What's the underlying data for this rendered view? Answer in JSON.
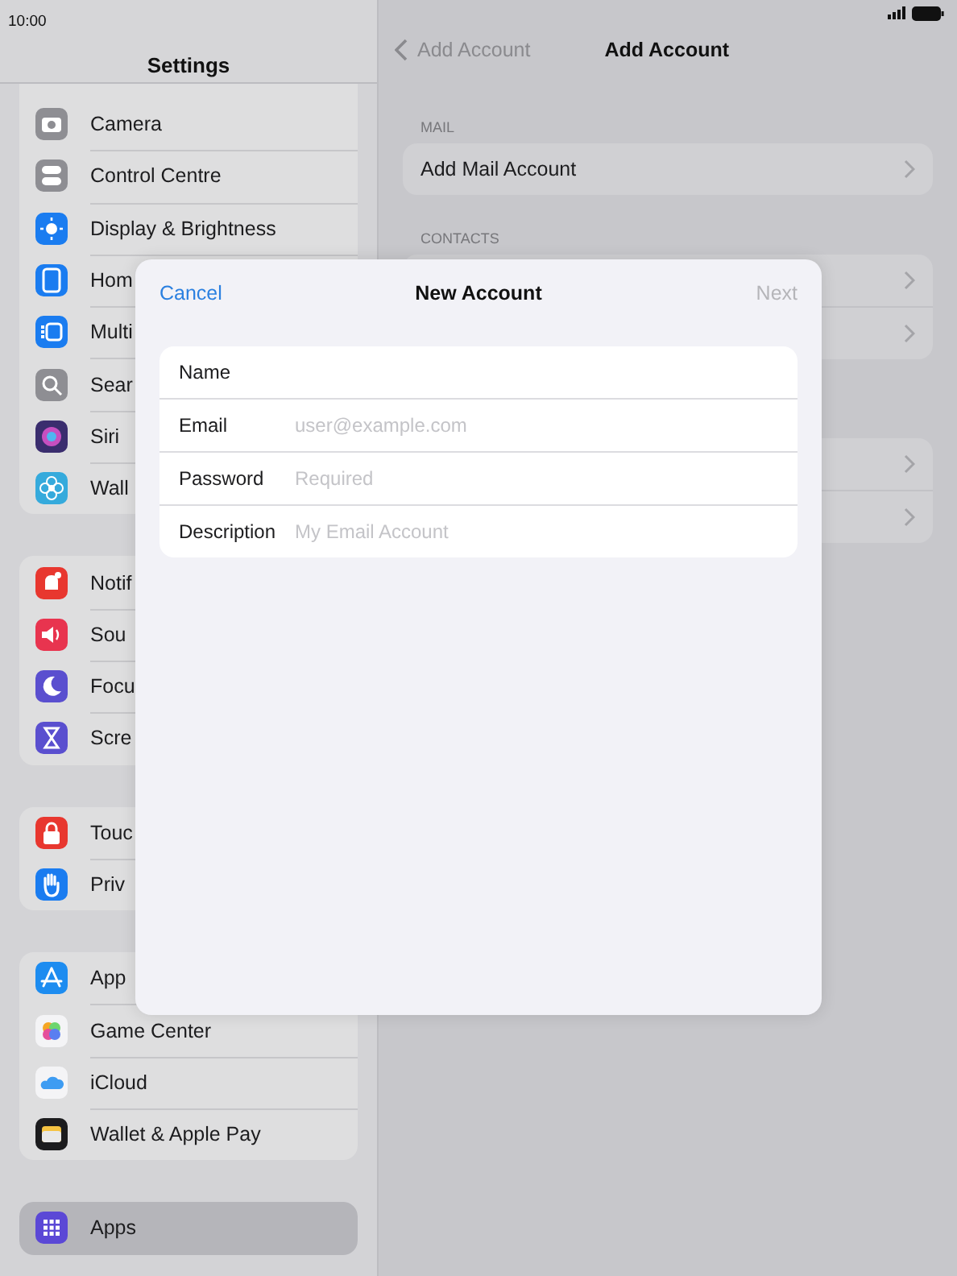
{
  "status_bar": {
    "time": "10:00"
  },
  "sidebar": {
    "title": "Settings",
    "groups": [
      {
        "items": [
          {
            "label": "Camera",
            "color": "#8e8e93",
            "selected": false
          },
          {
            "label": "Control Centre",
            "color": "#8e8e93",
            "selected": false
          },
          {
            "label": "Display & Brightness",
            "color": "#1a7cf0",
            "selected": false
          },
          {
            "label": "Hom",
            "color": "#1a7cf0",
            "selected": false
          },
          {
            "label": "Multi",
            "color": "#1a7cf0",
            "selected": false
          },
          {
            "label": "Sear",
            "color": "#8e8e93",
            "selected": false
          },
          {
            "label": "Siri",
            "color": "#3a2d6e",
            "selected": false
          },
          {
            "label": "Wall",
            "color": "#35aadc",
            "selected": false
          }
        ]
      },
      {
        "items": [
          {
            "label": "Notif",
            "color": "#e8372f",
            "selected": false
          },
          {
            "label": "Sou",
            "color": "#e8344f",
            "selected": false
          },
          {
            "label": "Focu",
            "color": "#5a4fcf",
            "selected": false
          },
          {
            "label": "Scre",
            "color": "#5a4fcf",
            "selected": false
          }
        ]
      },
      {
        "items": [
          {
            "label": "Touc",
            "color": "#e8372f",
            "selected": false
          },
          {
            "label": "Priv",
            "color": "#1a7cf0",
            "selected": false
          }
        ]
      },
      {
        "items": [
          {
            "label": "App",
            "color": "#1d8cf0",
            "selected": false
          },
          {
            "label": "Game Center",
            "color": "#f4f4f6",
            "selected": false
          },
          {
            "label": "iCloud",
            "color": "#f4f4f6",
            "selected": false
          },
          {
            "label": "Wallet & Apple Pay",
            "color": "#1c1c1e",
            "selected": false
          }
        ]
      },
      {
        "items": [
          {
            "label": "Apps",
            "color": "#5b48d6",
            "selected": true
          }
        ]
      }
    ]
  },
  "detail": {
    "back": "Add Account",
    "title": "Add Account",
    "sections": [
      {
        "header": "MAIL",
        "rows": [
          {
            "label": "Add Mail Account"
          }
        ]
      },
      {
        "header": "CONTACTS",
        "rows": [
          {},
          {}
        ]
      },
      {
        "rows": [
          {},
          {}
        ]
      }
    ]
  },
  "dialog": {
    "cancel": "Cancel",
    "title": "New Account",
    "next": {
      "label": "Next",
      "disabled": true
    },
    "fields": [
      {
        "label": "Name"
      },
      {
        "label": "Email",
        "placeholder": "user@example.com"
      },
      {
        "label": "Password",
        "placeholder": "Required"
      },
      {
        "label": "Description",
        "placeholder": "My Email Account"
      }
    ]
  }
}
